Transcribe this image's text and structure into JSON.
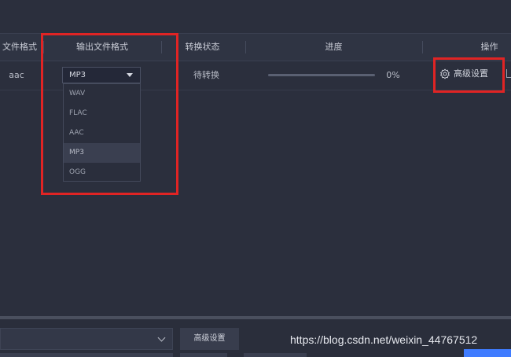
{
  "table": {
    "headers": {
      "input_format": "文件格式",
      "output_format": "输出文件格式",
      "status": "转换状态",
      "progress": "进度",
      "actions": "操作"
    },
    "row": {
      "input_format": "aac",
      "output_format": "MP3",
      "status": "待转换",
      "progress_text": "0%",
      "progress_value": 0,
      "advanced_label": "高级设置"
    }
  },
  "format_dropdown": {
    "selected": "MP3",
    "options": [
      "WAV",
      "FLAC",
      "AAC",
      "MP3",
      "OGG"
    ]
  },
  "bottom": {
    "advanced_button": "高级设置"
  },
  "watermark": "https://blog.csdn.net/weixin_44767512",
  "colors": {
    "background": "#2b2f3d",
    "highlight_box": "#e02424",
    "accent": "#3f7cff"
  }
}
